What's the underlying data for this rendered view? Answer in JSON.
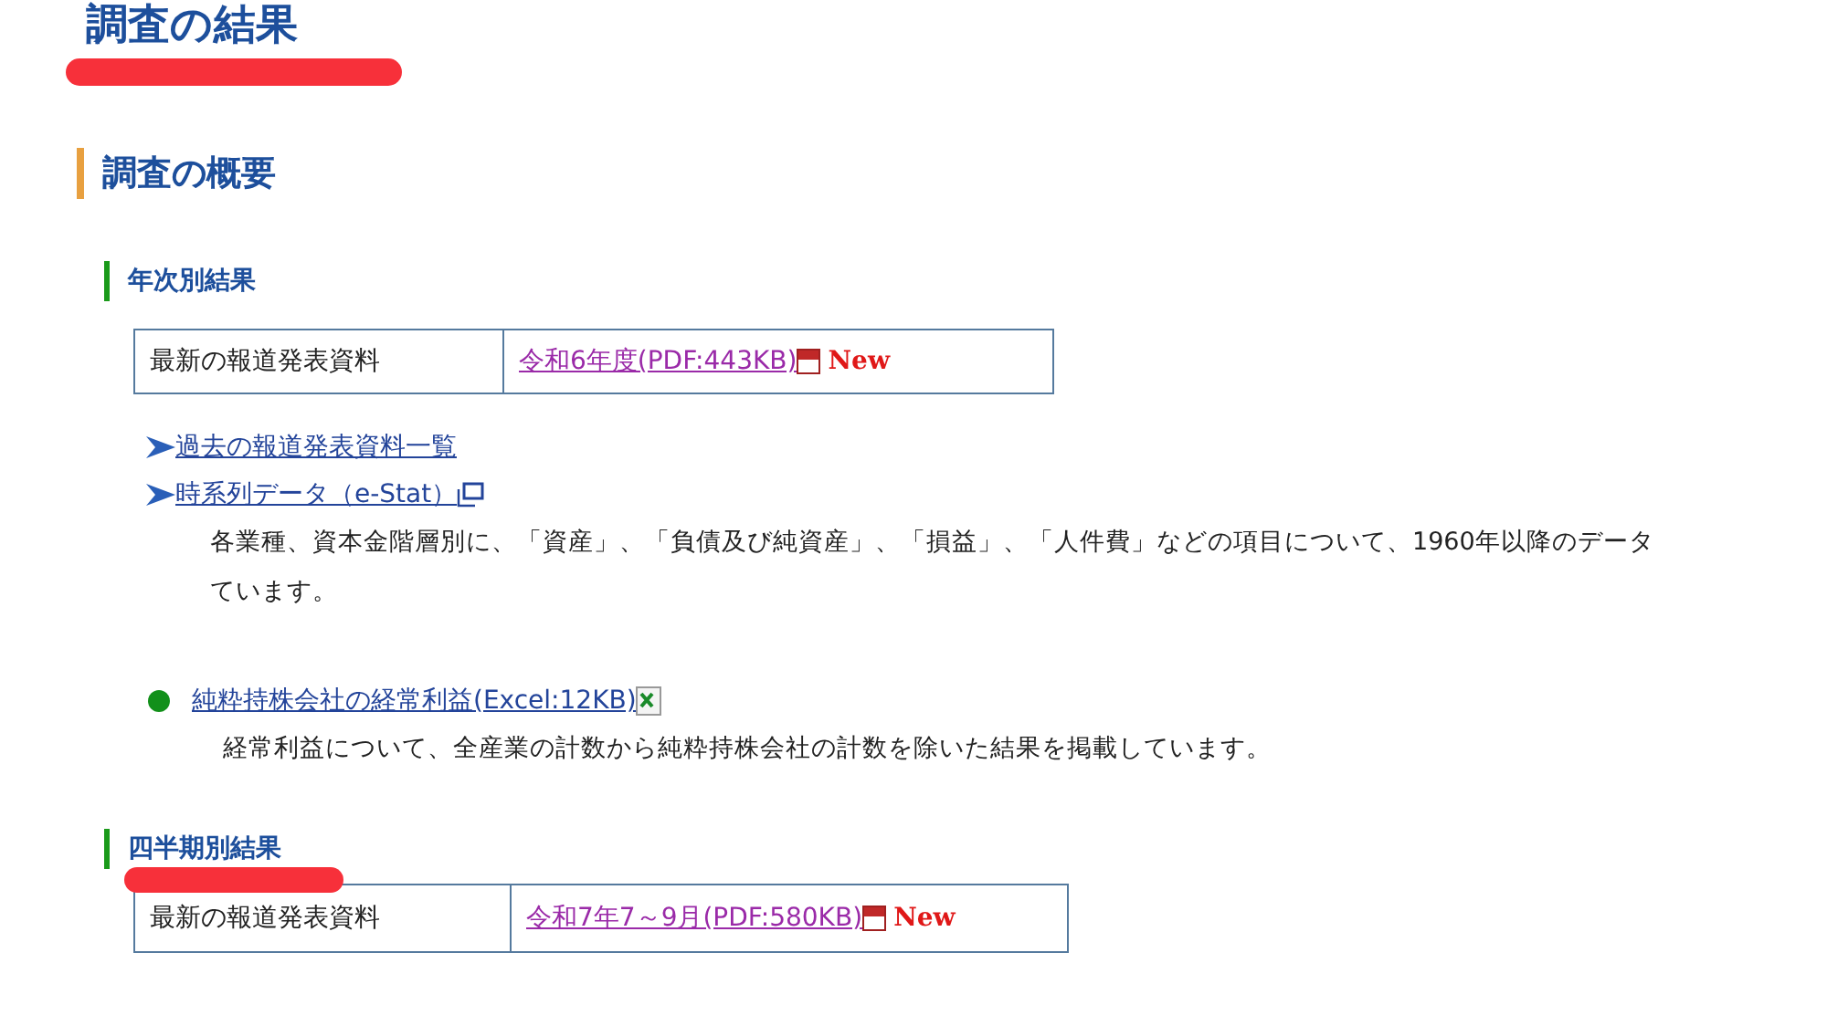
{
  "page_title": {
    "text": "調査の結果",
    "highlighted": true
  },
  "section": {
    "title": "調査の概要"
  },
  "annual": {
    "title": "年次別結果",
    "highlighted": false,
    "table": {
      "label": "最新の報道発表資料",
      "link": "令和6年度(PDF:443KB)",
      "badge": "New"
    },
    "links": [
      {
        "text": "過去の報道発表資料一覧",
        "external": false
      },
      {
        "text": "時系列データ（e-Stat）",
        "external": true
      }
    ],
    "description_lines": [
      "各業種、資本金階層別に、「資産」、「負債及び純資産」、「損益」、「人件費」などの項目について、1960年以降のデータ",
      "ています。"
    ],
    "bullet": {
      "link": "純粋持株会社の経常利益(Excel:12KB)",
      "description": "経常利益について、全産業の計数から純粋持株会社の計数を除いた結果を掲載しています。"
    }
  },
  "quarterly": {
    "title": "四半期別結果",
    "highlighted": true,
    "table": {
      "label": "最新の報道発表資料",
      "link": "令和7年7～9月(PDF:580KB)",
      "badge": "New"
    }
  }
}
